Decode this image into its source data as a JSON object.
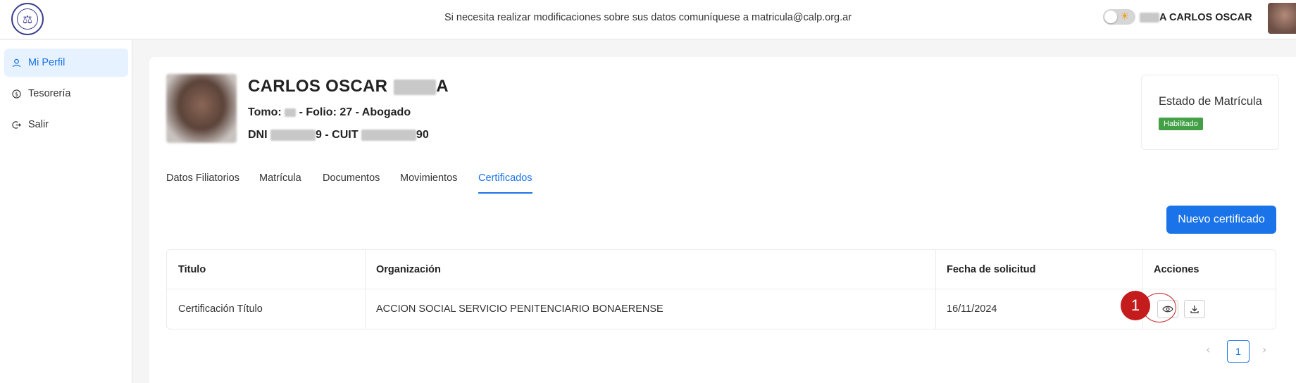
{
  "header": {
    "logo_icon": "scales-of-justice-seal-logo",
    "notice": "Si necesita realizar modificaciones sobre sus datos comuníquese a matricula@calp.org.ar",
    "theme_toggle_icon": "sun-icon",
    "user_name_visible": "A CARLOS OSCAR"
  },
  "sidebar": {
    "items": [
      {
        "label": "Mi Perfil",
        "icon": "user-icon"
      },
      {
        "label": "Tesorería",
        "icon": "dollar-circle-icon"
      },
      {
        "label": "Salir",
        "icon": "logout-icon"
      }
    ]
  },
  "profile": {
    "name_visible": "CARLOS OSCAR",
    "name_suffix": "A",
    "tomo_label": "Tomo:",
    "folio_text": "- Folio: 27 - Abogado",
    "dni_label": "DNI",
    "dni_suffix": "9 - CUIT",
    "cuit_suffix": "90"
  },
  "status": {
    "title": "Estado de Matrícula",
    "badge": "Habilitado",
    "badge_color": "#43a047"
  },
  "tabs": [
    {
      "label": "Datos Filiatorios"
    },
    {
      "label": "Matrícula"
    },
    {
      "label": "Documentos"
    },
    {
      "label": "Movimientos"
    },
    {
      "label": "Certificados",
      "active": true
    }
  ],
  "actions": {
    "new_certificate": "Nuevo certificado"
  },
  "table": {
    "headers": [
      "Titulo",
      "Organización",
      "Fecha de solicitud",
      "Acciones"
    ],
    "rows": [
      {
        "titulo": "Certificación Título",
        "organizacion": "ACCION SOCIAL SERVICIO PENITENCIARIO BONAERENSE",
        "fecha": "16/11/2024",
        "action_icons": [
          "eye-icon",
          "download-icon"
        ]
      }
    ]
  },
  "annotation": {
    "marker_label": "1",
    "color": "#c41c1c"
  },
  "pagination": {
    "current_page": "1",
    "prev_icon": "chevron-left-icon",
    "next_icon": "chevron-right-icon"
  },
  "colors": {
    "accent": "#1a73e8",
    "active_bg": "#e6f2ff"
  }
}
